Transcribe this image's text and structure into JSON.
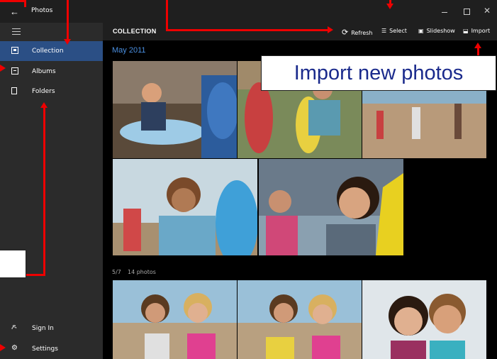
{
  "window": {
    "title": "Photos",
    "back_glyph": "←",
    "close_glyph": "✕"
  },
  "sidebar": {
    "items": [
      {
        "label": "Collection",
        "icon": "collection-icon",
        "active": true
      },
      {
        "label": "Albums",
        "icon": "albums-icon"
      },
      {
        "label": "Folders",
        "icon": "folder-icon"
      }
    ],
    "bottom": [
      {
        "label": "Sign In",
        "icon": "person-icon",
        "glyph": "ዶ"
      },
      {
        "label": "Settings",
        "icon": "gear-icon",
        "glyph": "⚙"
      }
    ]
  },
  "command_bar": {
    "heading": "COLLECTION",
    "refresh_label": "Refresh",
    "select_label": "Select",
    "slideshow_label": "Slideshow",
    "import_label": "Import",
    "refresh_glyph": "⟳",
    "select_glyph": "☰",
    "slideshow_glyph": "▣",
    "import_glyph": "⬓"
  },
  "content": {
    "section1_title": "May 2011",
    "section2_date": "5/7",
    "section2_count": "14 photos"
  },
  "annotation": {
    "callout_text": "Import new photos",
    "color": "#ee0000"
  },
  "colors": {
    "accent": "#2b4f85",
    "section_title": "#4a8fe0",
    "sidebar_bg": "#2b2b2b",
    "titlebar_bg": "#1f1f1f"
  }
}
